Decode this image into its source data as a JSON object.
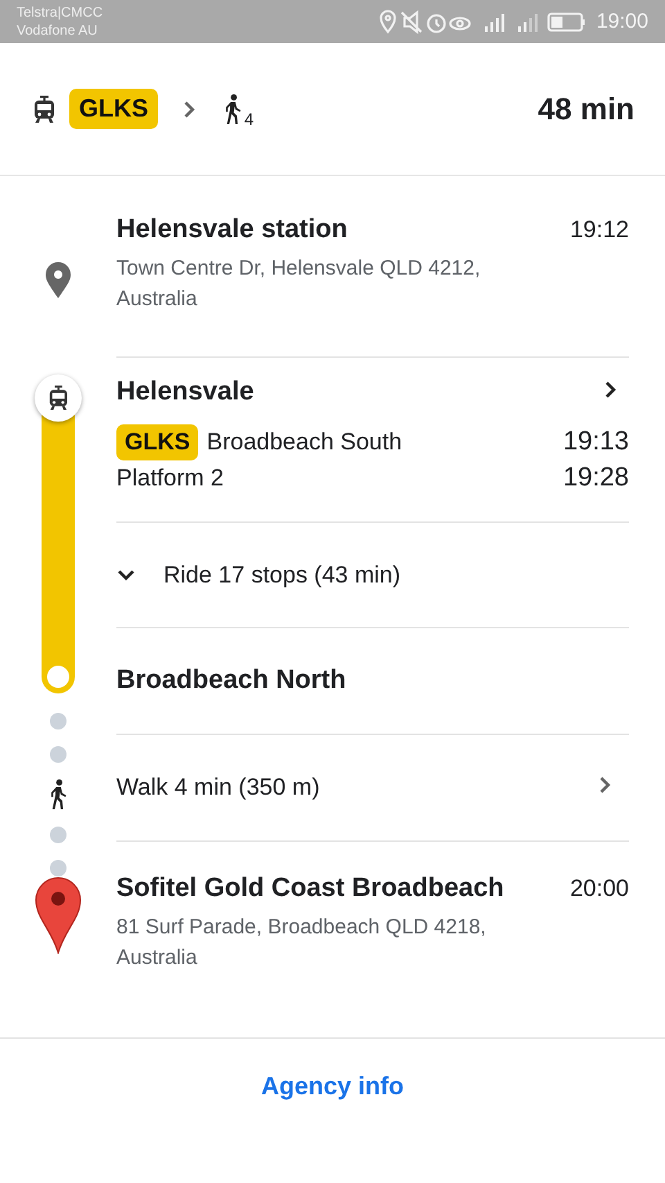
{
  "status_bar": {
    "carriers": [
      "Telstra|CMCC",
      "Vodafone AU"
    ],
    "time": "19:00"
  },
  "summary": {
    "route": "GLKS",
    "walk_minutes": "4",
    "duration": "48 min"
  },
  "steps": [
    {
      "kind": "origin",
      "title": "Helensvale station",
      "time": "19:12",
      "address": "Town Centre Dr, Helensvale QLD 4212, Australia"
    },
    {
      "kind": "transit",
      "title": "Helensvale",
      "route": "GLKS",
      "headsign": "Broadbeach South",
      "platform": "Platform 2",
      "depart": "19:13",
      "arrive": "19:28"
    },
    {
      "kind": "ride",
      "text": "Ride 17 stops (43 min)",
      "expanded": false
    },
    {
      "kind": "stop",
      "title": "Broadbeach North"
    },
    {
      "kind": "walk",
      "text": "Walk 4 min (350 m)"
    },
    {
      "kind": "destination",
      "title": "Sofitel Gold Coast Broadbeach",
      "time": "20:00",
      "address": "81 Surf Parade, Broadbeach QLD 4218, Australia"
    }
  ],
  "footer": {
    "link": "Agency info"
  }
}
